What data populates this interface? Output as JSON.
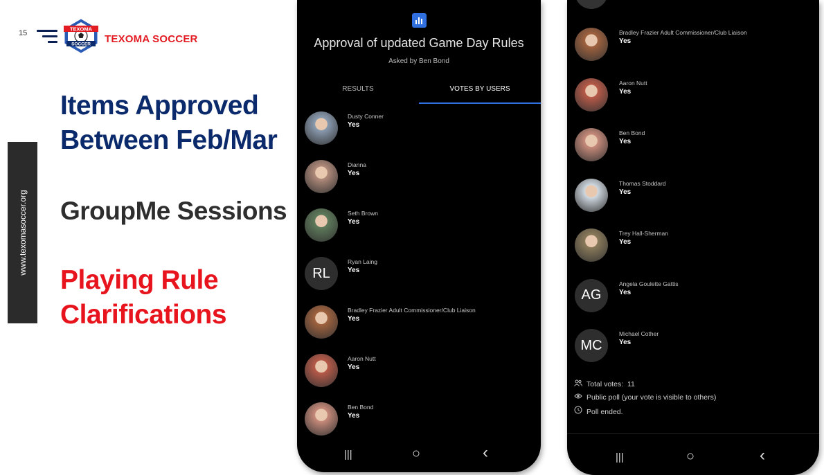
{
  "slide": {
    "number": "15",
    "brand": "TEXOMA SOCCER",
    "badge_top": "TEXOMA",
    "badge_bottom": "SOCCER",
    "website": "www.texomasoccer.org",
    "heading_1": "Items Approved Between Feb/Mar",
    "heading_2": "GroupMe Sessions",
    "heading_3": "Playing Rule Clarifications"
  },
  "poll": {
    "title": "Approval of updated Game Day Rules",
    "asked_by": "Asked by Ben Bond",
    "tabs": [
      "RESULTS",
      "VOTES BY USERS"
    ],
    "active_tab": "VOTES BY USERS"
  },
  "phone1_voters": [
    {
      "name": "Dusty Conner",
      "vote": "Yes",
      "avatar": "photo",
      "color": "#8a9bb0"
    },
    {
      "name": "Dianna",
      "vote": "Yes",
      "avatar": "photo",
      "color": "#b08a7a"
    },
    {
      "name": "Seth Brown",
      "vote": "Yes",
      "avatar": "photo",
      "color": "#5d7a5a"
    },
    {
      "name": "Ryan Laing",
      "vote": "Yes",
      "avatar": "initials",
      "initials": "RL"
    },
    {
      "name": "Bradley Frazier Adult Commissioner/Club Liaison",
      "vote": "Yes",
      "avatar": "photo",
      "color": "#a0623e"
    },
    {
      "name": "Aaron Nutt",
      "vote": "Yes",
      "avatar": "photo",
      "color": "#b85a48"
    },
    {
      "name": "Ben Bond",
      "vote": "Yes",
      "avatar": "photo",
      "color": "#c78a7a"
    }
  ],
  "phone2_voters": [
    {
      "name": "Bradley Frazier Adult Commissioner/Club Liaison",
      "vote": "Yes",
      "avatar": "photo",
      "color": "#a0623e"
    },
    {
      "name": "Aaron Nutt",
      "vote": "Yes",
      "avatar": "photo",
      "color": "#b85a48"
    },
    {
      "name": "Ben Bond",
      "vote": "Yes",
      "avatar": "photo",
      "color": "#c78a7a"
    },
    {
      "name": "Thomas Stoddard",
      "vote": "Yes",
      "avatar": "photo",
      "color": "#cfd8e0"
    },
    {
      "name": "Trey Hall-Sherman",
      "vote": "Yes",
      "avatar": "photo",
      "color": "#8a7a5a"
    },
    {
      "name": "Angela Goulette Gattis",
      "vote": "Yes",
      "avatar": "initials",
      "initials": "AG"
    },
    {
      "name": "Michael Cother",
      "vote": "Yes",
      "avatar": "initials",
      "initials": "MC"
    }
  ],
  "summary": {
    "total_votes_label": "Total votes:",
    "total_votes": "11",
    "visibility": "Public poll (your vote is visible to others)",
    "status": "Poll ended."
  },
  "navbar": {
    "recents": "|||",
    "home": "○",
    "back": "‹"
  },
  "colors": {
    "navy": "#0b2a6b",
    "red": "#e8141d",
    "accent": "#2f6fe0"
  }
}
